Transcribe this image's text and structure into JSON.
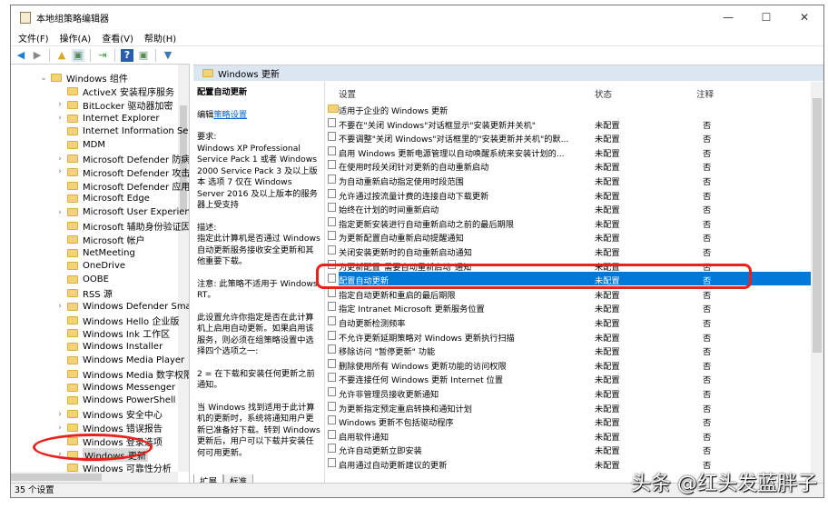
{
  "window": {
    "title": "本地组策略编辑器",
    "min": "—",
    "max": "☐",
    "close": "✕"
  },
  "menu": [
    "文件(F)",
    "操作(A)",
    "查看(V)",
    "帮助(H)"
  ],
  "tree": {
    "parent": "Windows 组件",
    "items": [
      {
        "label": "ActiveX 安装程序服务",
        "exp": false
      },
      {
        "label": "BitLocker 驱动器加密",
        "exp": true
      },
      {
        "label": "Internet Explorer",
        "exp": true
      },
      {
        "label": "Internet Information Serv",
        "exp": false
      },
      {
        "label": "MDM",
        "exp": false
      },
      {
        "label": "Microsoft Defender 防病毒",
        "exp": true
      },
      {
        "label": "Microsoft Defender 攻击防护",
        "exp": true
      },
      {
        "label": "Microsoft Defender 应用程序",
        "exp": false
      },
      {
        "label": "Microsoft Edge",
        "exp": false
      },
      {
        "label": "Microsoft User Experience",
        "exp": true
      },
      {
        "label": "Microsoft 辅助身份验证因素",
        "exp": false
      },
      {
        "label": "Microsoft 帐户",
        "exp": false
      },
      {
        "label": "NetMeeting",
        "exp": false
      },
      {
        "label": "OneDrive",
        "exp": false
      },
      {
        "label": "OOBE",
        "exp": false
      },
      {
        "label": "RSS 源",
        "exp": false
      },
      {
        "label": "Windows Defender Smar",
        "exp": true
      },
      {
        "label": "Windows Hello 企业版",
        "exp": false
      },
      {
        "label": "Windows Ink 工作区",
        "exp": false
      },
      {
        "label": "Windows Installer",
        "exp": false
      },
      {
        "label": "Windows Media Player",
        "exp": false
      },
      {
        "label": "Windows Media 数字权限",
        "exp": false
      },
      {
        "label": "Windows Messenger",
        "exp": false
      },
      {
        "label": "Windows PowerShell",
        "exp": false
      },
      {
        "label": "Windows 安全中心",
        "exp": true
      },
      {
        "label": "Windows 错误报告",
        "exp": true
      },
      {
        "label": "Windows 登录选项",
        "exp": false
      },
      {
        "label": "Windows 更新",
        "exp": true,
        "selected": true
      },
      {
        "label": "Windows 可靠性分析",
        "exp": false
      }
    ]
  },
  "header": {
    "title": "Windows 更新"
  },
  "description": {
    "title": "配置自动更新",
    "edit_prefix": "编辑",
    "edit_link": "策略设置",
    "req_label": "要求:",
    "req": "Windows XP Professional Service Pack 1 或者 Windows 2000 Service Pack 3 及以上版本 选项 7 仅在 Windows Server 2016 及以上版本的服务器上受支持",
    "desc_label": "描述:",
    "desc": "指定此计算机是否通过 Windows 自动更新服务接收安全更新和其他重要下载。",
    "note": "注意: 此策略不适用于 Windows RT。",
    "p1": "此设置允许你指定是否在此计算机上启用自动更新。如果启用该服务，则必须在组策略设置中选择四个选项之一:",
    "p2": "2 = 在下载和安装任何更新之前通知。",
    "p3": "当 Windows 找到适用于此计算机的更新时，系统将通知用户更新已准备好下载。转到 Windows 更新后，用户可以下载并安装任何可用更新。"
  },
  "columns": {
    "setting": "设置",
    "state": "状态",
    "comment": "注释"
  },
  "folder_row": "适用于企业的 Windows 更新",
  "rows": [
    {
      "name": "不要在\"关闭 Windows\"对话框显示\"安装更新并关机\"",
      "state": "未配置",
      "comment": "否"
    },
    {
      "name": "不要调整\"关闭 Windows\"对话框里的\"安装更新并关机\"的默...",
      "state": "未配置",
      "comment": "否"
    },
    {
      "name": "启用 Windows 更新电源管理以自动唤醒系统来安装计划的...",
      "state": "未配置",
      "comment": "否"
    },
    {
      "name": "在使用时段关闭针对更新的自动重新启动",
      "state": "未配置",
      "comment": "否"
    },
    {
      "name": "为自动重新启动指定使用时段范围",
      "state": "未配置",
      "comment": "否"
    },
    {
      "name": "允许通过按流量计费的连接自动下载更新",
      "state": "未配置",
      "comment": "否"
    },
    {
      "name": "始终在计划的时间重新启动",
      "state": "未配置",
      "comment": "否"
    },
    {
      "name": "指定更新安装进行自动重新启动之前的最后期限",
      "state": "未配置",
      "comment": "否"
    },
    {
      "name": "为更新配置自动重新启动提醒通知",
      "state": "未配置",
      "comment": "否"
    },
    {
      "name": "关闭安装更新时的自动重新启动通知",
      "state": "未配置",
      "comment": "否"
    },
    {
      "name": "为更新配置\"需要自动重新启动\"通知",
      "state": "未配置",
      "comment": "否"
    },
    {
      "name": "配置自动更新",
      "state": "未配置",
      "comment": "否",
      "selected": true
    },
    {
      "name": "指定自动更新和重启的最后期限",
      "state": "未配置",
      "comment": "否"
    },
    {
      "name": "指定 Intranet Microsoft 更新服务位置",
      "state": "未配置",
      "comment": "否"
    },
    {
      "name": "自动更新检测频率",
      "state": "未配置",
      "comment": "否"
    },
    {
      "name": "不允许更新延期策略对 Windows 更新执行扫描",
      "state": "未配置",
      "comment": "否"
    },
    {
      "name": "移除访问 \"暂停更新\" 功能",
      "state": "未配置",
      "comment": "否"
    },
    {
      "name": "删除使用所有 Windows 更新功能的访问权限",
      "state": "未配置",
      "comment": "否"
    },
    {
      "name": "不要连接任何 Windows 更新 Internet 位置",
      "state": "未配置",
      "comment": "否"
    },
    {
      "name": "允许非管理员接收更新通知",
      "state": "未配置",
      "comment": "否"
    },
    {
      "name": "为更新指定预定重启转换和通知计划",
      "state": "未配置",
      "comment": "否"
    },
    {
      "name": "Windows 更新不包括驱动程序",
      "state": "未配置",
      "comment": "否"
    },
    {
      "name": "启用软件通知",
      "state": "未配置",
      "comment": "否"
    },
    {
      "name": "允许自动更新立即安装",
      "state": "未配置",
      "comment": "否"
    },
    {
      "name": "启用通过自动更新建议的更新",
      "state": "未配置",
      "comment": "否"
    }
  ],
  "tabs": [
    "扩展",
    "标准"
  ],
  "status": "35 个设置",
  "watermark": "头条 @红头发蓝胖子",
  "colors": {
    "selection": "#0078d7",
    "annotation": "#e8221b"
  }
}
